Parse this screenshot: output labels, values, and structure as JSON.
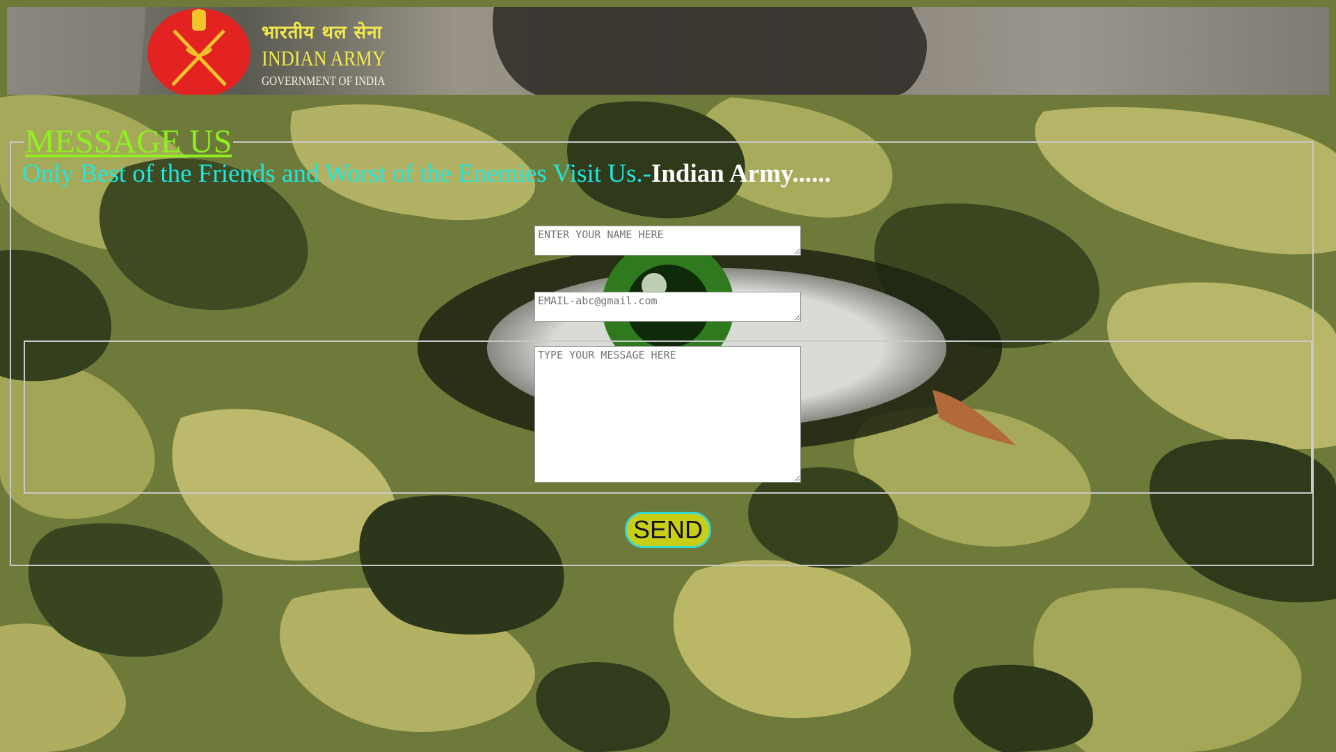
{
  "header": {
    "hindi_title": "भारतीय थल सेना",
    "title": "INDIAN ARMY",
    "subtitle": "GOVERNMENT OF INDIA",
    "emblem_icon": "army-emblem-icon"
  },
  "form": {
    "legend": "MESSAGE US",
    "quote_prefix": "Only Best of the Friends and Worst of the Enemies Visit Us.-",
    "quote_author": "Indian Army......",
    "name_placeholder": "ENTER YOUR NAME HERE",
    "email_placeholder": "EMAIL-abc@gmail.com",
    "message_placeholder": "TYPE YOUR MESSAGE HERE",
    "send_label": "SEND"
  },
  "colors": {
    "legend": "#8ef01e",
    "quote": "#1ee8e0",
    "send_bg": "#c9cf16",
    "send_border": "#35d9d4",
    "brand_yellow": "#f2ea4c"
  }
}
